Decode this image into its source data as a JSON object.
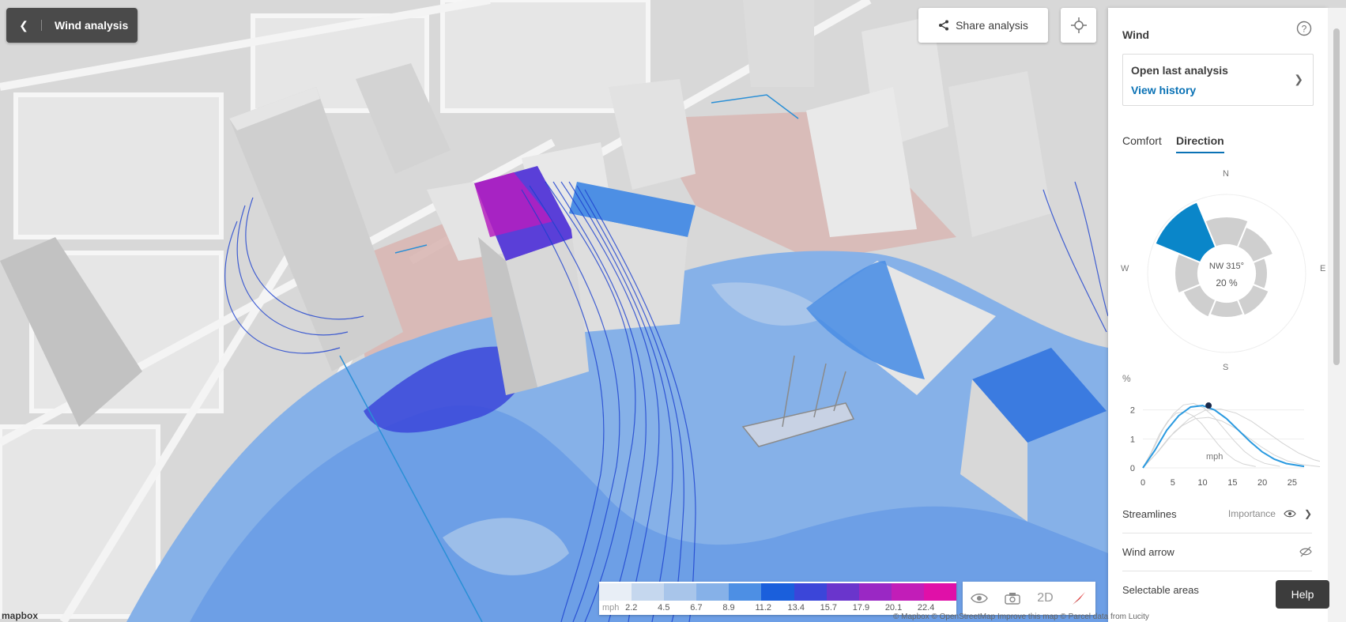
{
  "header": {
    "title": "Wind analysis",
    "share_label": "Share analysis"
  },
  "panel": {
    "title": "Wind",
    "open_last": {
      "title": "Open last analysis",
      "link": "View history"
    },
    "tabs": [
      {
        "label": "Comfort",
        "active": false
      },
      {
        "label": "Direction",
        "active": true
      }
    ],
    "compass": {
      "n": "N",
      "e": "E",
      "s": "S",
      "w": "W",
      "direction": "NW 315°",
      "percent": "20 %"
    },
    "speed_chart": {
      "ylabel": "%",
      "unit": "mph",
      "y_ticks": [
        "2",
        "1",
        "0"
      ],
      "x_ticks": [
        "0",
        "5",
        "10",
        "15",
        "20",
        "25"
      ]
    },
    "rows": [
      {
        "label": "Streamlines",
        "extra": "Importance"
      },
      {
        "label": "Wind arrow"
      },
      {
        "label": "Selectable areas"
      }
    ],
    "help_label": "Help"
  },
  "legend": {
    "unit": "mph",
    "ticks": [
      "2.2",
      "4.5",
      "6.7",
      "8.9",
      "11.2",
      "13.4",
      "15.7",
      "17.9",
      "20.1",
      "22.4"
    ],
    "colors": [
      "#e8eef6",
      "#c5d7ee",
      "#a8c5ea",
      "#86b1e8",
      "#4d8fe4",
      "#1a5fdc",
      "#3b46d9",
      "#6a35cc",
      "#9a28c4",
      "#c21db8",
      "#e010a8"
    ]
  },
  "tools": {
    "mode_label": "2D"
  },
  "map": {
    "logo": "mapbox",
    "attribution": "© Mapbox © OpenStreetMap Improve this map © Parcel data from Lucity"
  },
  "chart_data": {
    "type": "line",
    "xlabel": "mph",
    "ylabel": "%",
    "xlim": [
      0,
      27
    ],
    "ylim": [
      0,
      2.4
    ],
    "series": [
      {
        "x": [
          0,
          2,
          4,
          6,
          8,
          10,
          12,
          14,
          16,
          18,
          20,
          22,
          24,
          27
        ],
        "y": [
          0,
          0.6,
          1.3,
          1.8,
          2.1,
          2.15,
          2.0,
          1.7,
          1.3,
          0.9,
          0.55,
          0.3,
          0.15,
          0.05
        ]
      }
    ],
    "highlight": {
      "x": 11,
      "y": 2.15
    }
  },
  "compass_data": {
    "highlight_dir": "NW",
    "highlight_deg": 315,
    "percent": 20
  }
}
